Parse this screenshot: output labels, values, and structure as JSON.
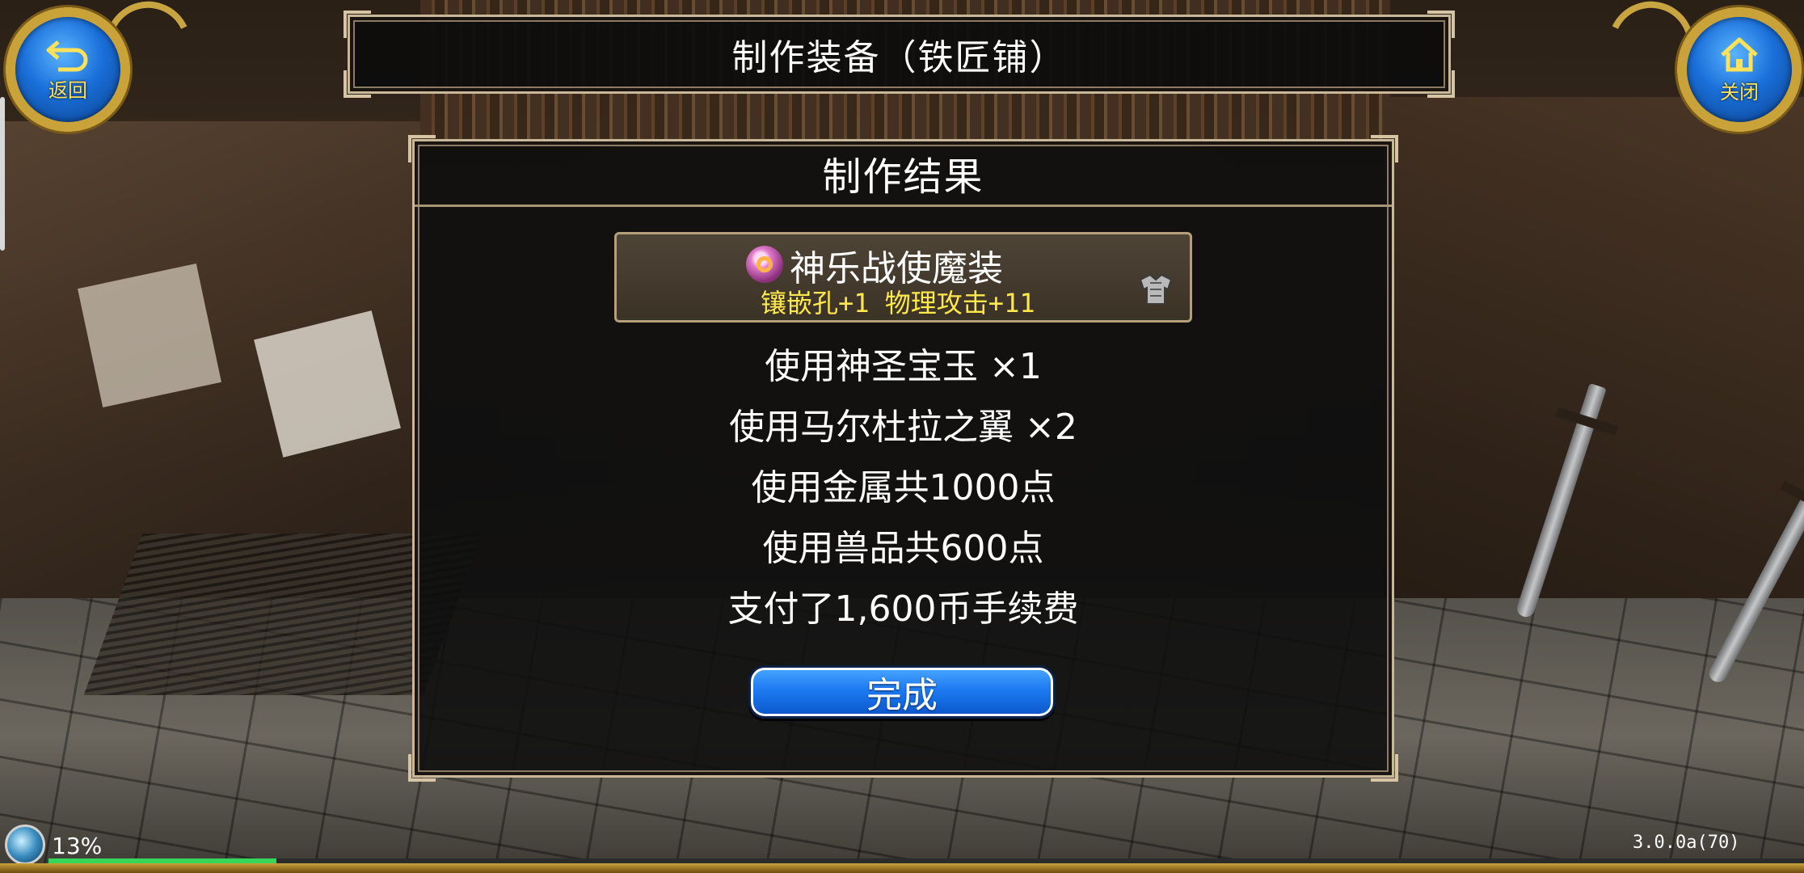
{
  "header": {
    "title": "制作装备（铁匠铺）",
    "back_label": "返回",
    "close_label": "关闭"
  },
  "panel": {
    "title": "制作结果",
    "item": {
      "name": "神乐战使魔装",
      "stats": "镶嵌孔+1 物理攻击+11",
      "gem_icon": "ring-icon",
      "armor_icon": "armor-icon"
    },
    "lines": [
      "使用神圣宝玉 ×1",
      "使用马尔杜拉之翼 ×2",
      "使用金属共1000点",
      "使用兽品共600点",
      "支付了1,600币手续费"
    ],
    "done_label": "完成"
  },
  "status": {
    "progress_text": "13%",
    "progress_value": 0.13,
    "version": "3.0.0a(70)"
  },
  "colors": {
    "accent_gold": "#c9a23a",
    "button_blue": "#1d7bf2",
    "stats_yellow": "#ffe84a",
    "progress_green": "#35d65a"
  }
}
